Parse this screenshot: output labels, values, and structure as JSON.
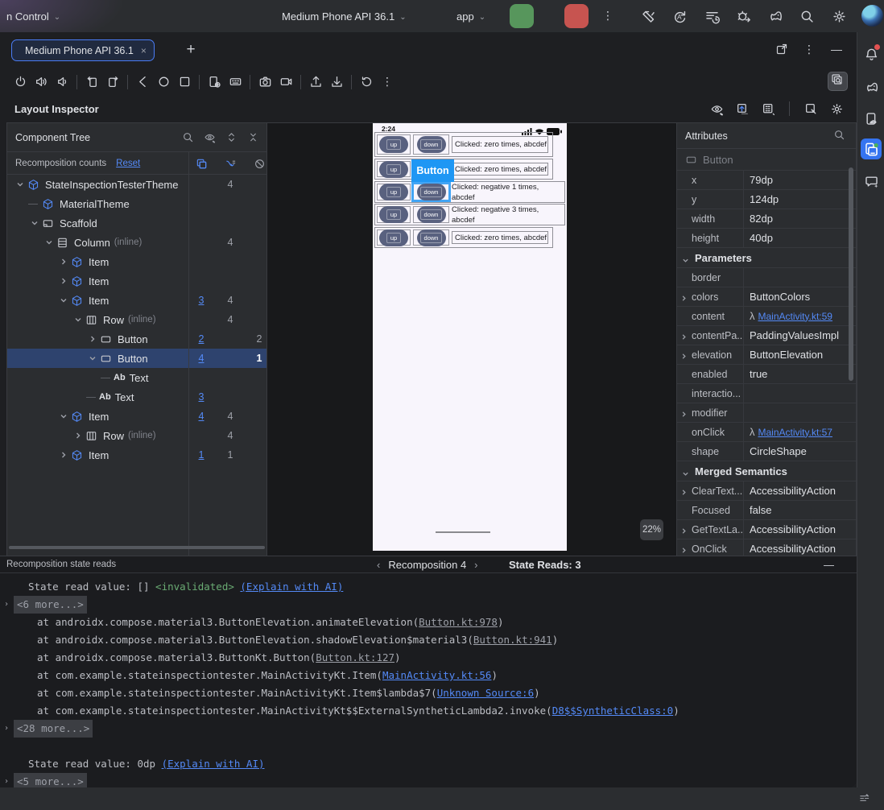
{
  "colors": {
    "accent": "#3574f0",
    "link": "#548af7",
    "run_green": "#57965c",
    "stop_red": "#c75450",
    "selection": "#2e436e",
    "invalidated_green": "#6aab73",
    "phone_button": "#59617f",
    "button_overlay_blue": "#1f97f4"
  },
  "titlebar": {
    "vcs_label": "n Control",
    "device_selector": "Medium Phone API 36.1",
    "run_config": "app",
    "actions": [
      "build",
      "apply-changes",
      "profiler",
      "attach-debugger",
      "gradle-sync",
      "search",
      "settings"
    ]
  },
  "tabbar": {
    "tab_label": "Medium Phone API 36.1",
    "close": "×",
    "plus": "+",
    "window_actions": [
      "open-new",
      "kebab",
      "minus"
    ]
  },
  "emulator": {
    "toolbar_groups": [
      [
        "power",
        "volume-up",
        "volume-down"
      ],
      [
        "rotate-left",
        "rotate-right"
      ],
      [
        "back",
        "home",
        "overview"
      ],
      [
        "snapshot",
        "input"
      ],
      [
        "camera",
        "record"
      ],
      [
        "upload",
        "download"
      ],
      [
        "restore",
        "kebab"
      ]
    ],
    "inspect_toggle": "inspect",
    "ready_check": "✓"
  },
  "inspector": {
    "title": "Layout Inspector",
    "toolbar": [
      "eye",
      "export",
      "tree-opts",
      "|",
      "pick",
      "settings"
    ]
  },
  "tree": {
    "header": "Component Tree",
    "header_icons": [
      "search",
      "eye",
      "expand",
      "collapse"
    ],
    "counts_label": "Recomposition counts",
    "reset_label": "Reset",
    "count_col_icons": [
      "counts",
      "skips",
      "clear"
    ],
    "nodes": [
      {
        "level": 0,
        "chev": "down",
        "icon": "compose",
        "label": "StateInspectionTesterTheme",
        "c2": "4"
      },
      {
        "level": 1,
        "chev": null,
        "icon": "compose",
        "label": "MaterialTheme",
        "conn": true
      },
      {
        "level": 1,
        "chev": "down",
        "icon": "scaffold",
        "label": "Scaffold"
      },
      {
        "level": 2,
        "chev": "down",
        "icon": "column",
        "label": "Column",
        "suffix": "(inline)",
        "c2": "4"
      },
      {
        "level": 3,
        "chev": "right",
        "icon": "compose",
        "label": "Item"
      },
      {
        "level": 3,
        "chev": "right",
        "icon": "compose",
        "label": "Item"
      },
      {
        "level": 3,
        "chev": "down",
        "icon": "compose",
        "label": "Item",
        "c1": "3",
        "c2": "4"
      },
      {
        "level": 4,
        "chev": "down",
        "icon": "row",
        "label": "Row",
        "suffix": "(inline)",
        "c2": "4"
      },
      {
        "level": 5,
        "chev": "right",
        "icon": "button",
        "label": "Button",
        "c1": "2",
        "c3": "2"
      },
      {
        "level": 5,
        "chev": "down",
        "icon": "button",
        "label": "Button",
        "c1": "4",
        "c3": "1",
        "selected": true,
        "c3bold": true
      },
      {
        "level": 6,
        "chev": null,
        "icon": "text",
        "label": "Text",
        "conn": true
      },
      {
        "level": 5,
        "chev": null,
        "icon": "text",
        "label": "Text",
        "conn": true,
        "c1": "3"
      },
      {
        "level": 3,
        "chev": "down",
        "icon": "compose",
        "label": "Item",
        "c1": "4",
        "c2": "4"
      },
      {
        "level": 4,
        "chev": "right",
        "icon": "row",
        "label": "Row",
        "suffix": "(inline)",
        "c2": "4"
      },
      {
        "level": 3,
        "chev": "right",
        "icon": "compose",
        "label": "Item",
        "c1": "1",
        "c2": "1"
      }
    ]
  },
  "device": {
    "time": "2:24",
    "zoom_level": "22%",
    "up_label": "up",
    "down_label": "down",
    "overlay_label": "Button",
    "rows": [
      {
        "text": "Clicked: zero times, abcdef",
        "boxed": true
      },
      {
        "text": "Clicked: zero times, abcdef",
        "boxed": true,
        "overlay": true
      },
      {
        "text": "Clicked: negative 1 times, abcdef",
        "wide": true,
        "down_selected": true
      },
      {
        "text": "Clicked: negative 3 times, abcdef",
        "wide": true
      },
      {
        "text": "Clicked: zero times, abcdef",
        "boxed": true
      }
    ]
  },
  "attributes": {
    "header": "Attributes",
    "component": "Button",
    "props": [
      {
        "k": "x",
        "v": "79dp"
      },
      {
        "k": "y",
        "v": "124dp"
      },
      {
        "k": "width",
        "v": "82dp"
      },
      {
        "k": "height",
        "v": "40dp"
      }
    ],
    "parameters_label": "Parameters",
    "params": [
      {
        "k": "border",
        "v": ""
      },
      {
        "k": "colors",
        "v": "ButtonColors",
        "chev": true
      },
      {
        "k": "content",
        "v": "MainActivity.kt:59",
        "lambda": true,
        "link": true
      },
      {
        "k": "contentPa...",
        "v": "PaddingValuesImpl",
        "chev": true
      },
      {
        "k": "elevation",
        "v": "ButtonElevation",
        "chev": true
      },
      {
        "k": "enabled",
        "v": "true"
      },
      {
        "k": "interactio...",
        "v": ""
      },
      {
        "k": "modifier",
        "v": "",
        "chev": true
      },
      {
        "k": "onClick",
        "v": "MainActivity.kt:57",
        "lambda": true,
        "link": true
      },
      {
        "k": "shape",
        "v": "CircleShape"
      }
    ],
    "semantics_label": "Merged Semantics",
    "semantics": [
      {
        "k": "ClearText...",
        "v": "AccessibilityAction",
        "chev": true
      },
      {
        "k": "Focused",
        "v": "false"
      },
      {
        "k": "GetTextLa...",
        "v": "AccessibilityAction",
        "chev": true
      },
      {
        "k": "OnClick",
        "v": "AccessibilityAction",
        "chev": true
      }
    ]
  },
  "bottom": {
    "title": "Recomposition state reads",
    "nav_prev": "‹",
    "nav_label": "Recomposition 4",
    "nav_next": "›",
    "state_reads": "State Reads: 3",
    "minimize": "—",
    "lines": [
      {
        "type": "read",
        "pre": "State read value: [] ",
        "tag": "<invalidated>",
        "link": "(Explain with AI)"
      },
      {
        "type": "more",
        "text": "<6 more...>"
      },
      {
        "type": "frame",
        "pre": "at androidx.compose.material3.ButtonElevation.animateElevation(",
        "link": "Button.kt:978",
        "style": "gray",
        "post": ")"
      },
      {
        "type": "frame",
        "pre": "at androidx.compose.material3.ButtonElevation.shadowElevation$material3(",
        "link": "Button.kt:941",
        "style": "gray",
        "post": ")"
      },
      {
        "type": "frame",
        "pre": "at androidx.compose.material3.ButtonKt.Button(",
        "link": "Button.kt:127",
        "style": "gray",
        "post": ")"
      },
      {
        "type": "frame",
        "pre": "at com.example.stateinspectiontester.MainActivityKt.Item(",
        "link": "MainActivity.kt:56",
        "style": "blue",
        "post": ")"
      },
      {
        "type": "frame",
        "pre": "at com.example.stateinspectiontester.MainActivityKt.Item$lambda$7(",
        "link": "Unknown Source:6",
        "style": "blue",
        "post": ")"
      },
      {
        "type": "frame",
        "pre": "at com.example.stateinspectiontester.MainActivityKt$$ExternalSyntheticLambda2.invoke(",
        "link": "D8$$SyntheticClass:0",
        "style": "blue",
        "post": ")"
      },
      {
        "type": "more",
        "text": "<28 more...>"
      },
      {
        "type": "blank"
      },
      {
        "type": "read",
        "pre": "State read value: 0dp ",
        "tag": null,
        "link": "(Explain with AI)"
      },
      {
        "type": "more",
        "text": "<5 more...>"
      }
    ]
  },
  "right_rail": {
    "items": [
      "bell",
      "gradle",
      "device-manager",
      "running-devices",
      "ai-chat"
    ],
    "bottom_icon": "adjust"
  }
}
